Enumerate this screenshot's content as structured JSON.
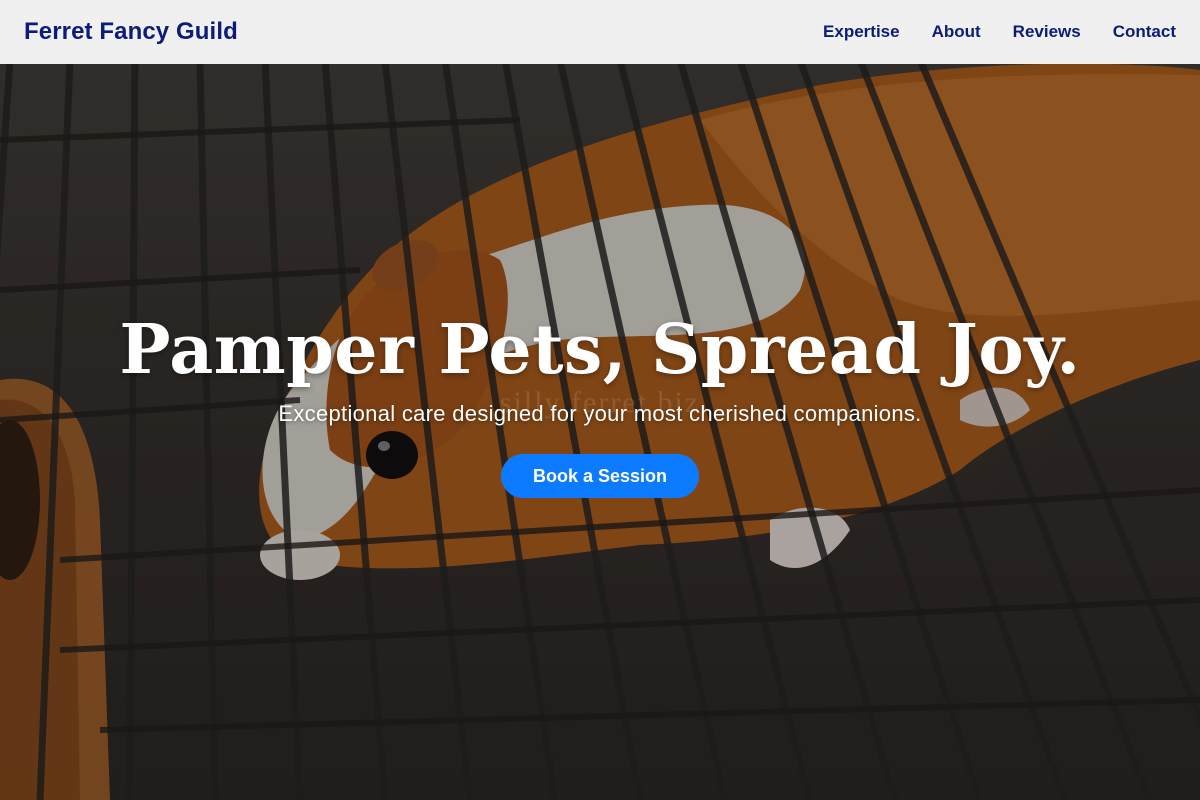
{
  "header": {
    "brand": "Ferret Fancy Guild",
    "nav": [
      {
        "label": "Expertise"
      },
      {
        "label": "About"
      },
      {
        "label": "Reviews"
      },
      {
        "label": "Contact"
      }
    ]
  },
  "hero": {
    "title": "Pamper Pets, Spread Joy.",
    "subtitle": "Exceptional care designed for your most cherished companions.",
    "cta_label": "Book a Session",
    "watermark": "silly ferret biz",
    "background_subject": "guinea-pig-on-wire-grate"
  },
  "colors": {
    "brand_text": "#0d1b7a",
    "header_bg": "#f7f7f7",
    "cta_bg": "#0d7bff",
    "hero_text": "#ffffff"
  }
}
